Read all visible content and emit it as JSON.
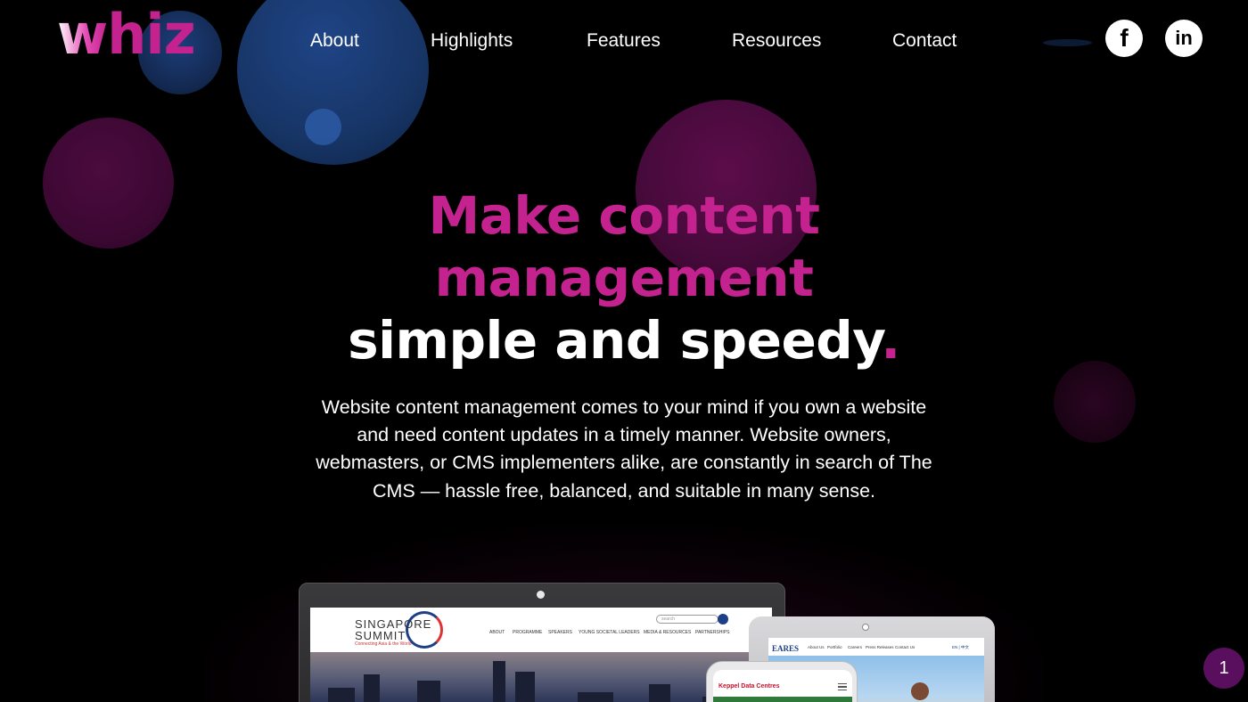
{
  "brand": {
    "logo_w": "w",
    "logo_rest": "hiz"
  },
  "nav": {
    "items": [
      {
        "label": "About"
      },
      {
        "label": "Highlights"
      },
      {
        "label": "Features"
      },
      {
        "label": "Resources"
      },
      {
        "label": "Contact"
      }
    ]
  },
  "social": {
    "facebook_glyph": "f",
    "linkedin_glyph": "in"
  },
  "hero": {
    "line1": "Make content",
    "line2": "management",
    "line3": "simple and speedy",
    "dot": ".",
    "description": "Website content management comes to your mind if you own a website and need content updates in a timely manner. Website owners, webmasters, or CMS implementers alike, are constantly in search of The CMS — hassle free, balanced, and suitable in many sense."
  },
  "mockups": {
    "laptop": {
      "logo": "SINGAPORE SUMMIT",
      "tagline": "Connecting Asia & the World",
      "search_placeholder": "search",
      "nav": [
        "ABOUT",
        "PROGRAMME",
        "SPEAKERS",
        "YOUNG SOCIETAL LEADERS",
        "MEDIA & RESOURCES",
        "PARTNERSHIPS"
      ]
    },
    "tablet": {
      "brand": "EARES",
      "nav": [
        "About Us",
        "Portfolio",
        "Careers",
        "Press Releases",
        "Contact Us"
      ],
      "lang": "EN | 中文"
    },
    "phone": {
      "brand": "Keppel Data Centres"
    }
  },
  "pagination": {
    "current": "1"
  },
  "colors": {
    "accent": "#c4238f",
    "background": "#000000",
    "badge": "#5a0f5e"
  }
}
